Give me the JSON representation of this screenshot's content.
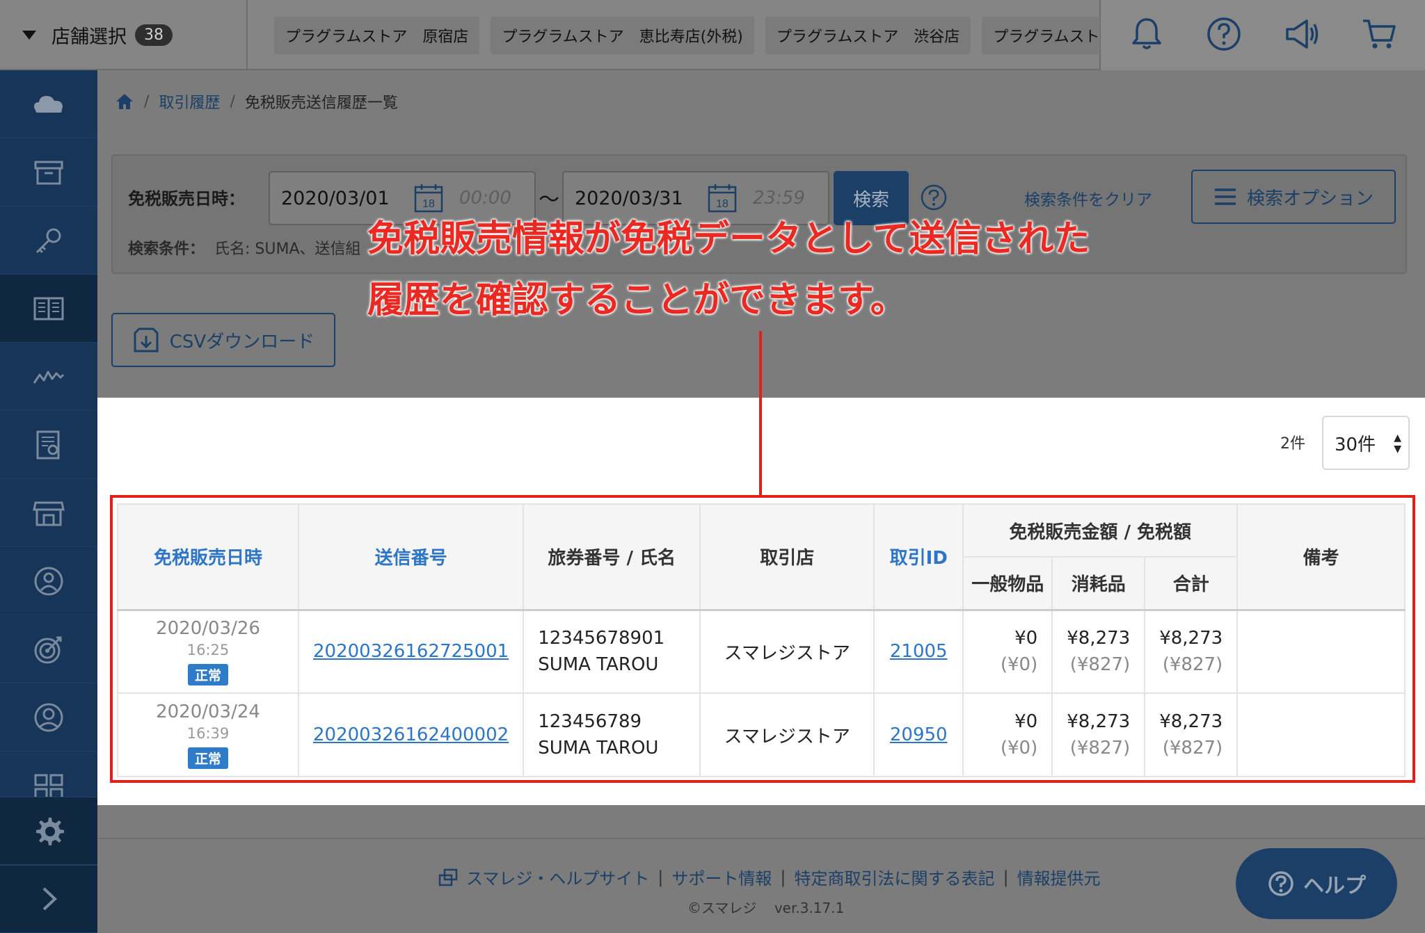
{
  "header": {
    "store_select_label": "店舗選択",
    "store_count": "38",
    "stores": [
      "プラグラムストア　原宿店",
      "プラグラムストア　恵比寿店(外税)",
      "プラグラムストア　渋谷店",
      "プラグラムストア"
    ],
    "icons": [
      "bell-icon",
      "question-icon",
      "megaphone-icon",
      "cart-icon"
    ]
  },
  "sidebar": {
    "items": [
      "cloud-icon",
      "archive-icon",
      "key-icon",
      "book-icon",
      "chart-icon",
      "report-icon",
      "store-icon",
      "user-icon",
      "target-icon",
      "person-icon",
      "grid-icon"
    ],
    "active_index": 3,
    "bottom": [
      "gear-icon",
      "chevron-right-icon"
    ]
  },
  "breadcrumb": {
    "home_icon": "home-icon",
    "link": "取引履歴",
    "current": "免税販売送信履歴一覧"
  },
  "search": {
    "label": "免税販売日時：",
    "from_date": "2020/03/01",
    "from_time": "00:00",
    "to_date": "2020/03/31",
    "to_time": "23:59",
    "calendar_day": "18",
    "tilde": "〜",
    "button": "検索",
    "clear": "検索条件をクリア",
    "options": "検索オプション",
    "conditions_label": "検索条件：",
    "conditions_value": "氏名: SUMA、送信組"
  },
  "csv_button": "CSVダウンロード",
  "annotation": {
    "line1": "免税販売情報が免税データとして送信された",
    "line2": "履歴を確認することができます。"
  },
  "list": {
    "count": "2件",
    "per_page": "30件",
    "headers": {
      "date": "免税販売日時",
      "send_no": "送信番号",
      "passport": "旅券番号 / 氏名",
      "store": "取引店",
      "tx_id": "取引ID",
      "amount_group": "免税販売金額 / 免税額",
      "general": "一般物品",
      "consumable": "消耗品",
      "total": "合計",
      "note": "備考"
    },
    "rows": [
      {
        "date": "2020/03/26",
        "time": "16:25",
        "status": "正常",
        "send_no": "20200326162725001",
        "passport_no": "12345678901",
        "name": "SUMA TAROU",
        "store": "スマレジストア",
        "tx_id": "21005",
        "general": "¥0",
        "general_tax": "(¥0)",
        "consumable": "¥8,273",
        "consumable_tax": "(¥827)",
        "total": "¥8,273",
        "total_tax": "(¥827)",
        "note": ""
      },
      {
        "date": "2020/03/24",
        "time": "16:39",
        "status": "正常",
        "send_no": "20200326162400002",
        "passport_no": "123456789",
        "name": "SUMA TAROU",
        "store": "スマレジストア",
        "tx_id": "20950",
        "general": "¥0",
        "general_tax": "(¥0)",
        "consumable": "¥8,273",
        "consumable_tax": "(¥827)",
        "total": "¥8,273",
        "total_tax": "(¥827)",
        "note": ""
      }
    ]
  },
  "footer": {
    "links": [
      "スマレジ・ヘルプサイト",
      "サポート情報",
      "特定商取引法に関する表記",
      "情報提供元"
    ],
    "copyright": "©スマレジ",
    "version": "ver.3.17.1",
    "help_button": "ヘルプ"
  },
  "colors": {
    "sidebar": "#163558",
    "accent": "#2d75c7",
    "annotation": "#e3211b",
    "status": "#2e7cc9"
  }
}
